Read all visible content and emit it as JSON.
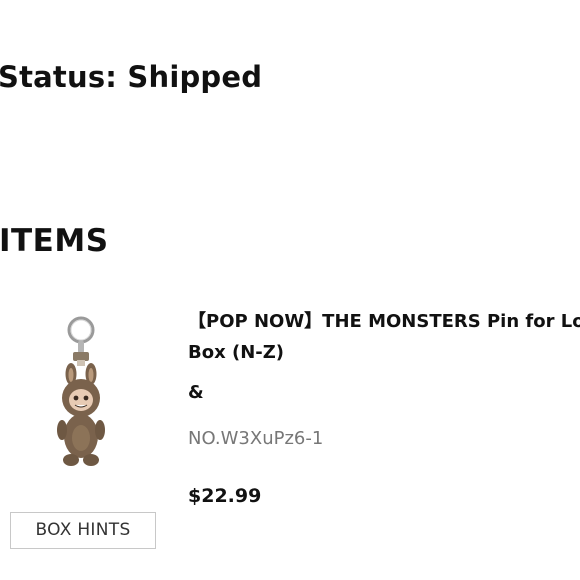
{
  "order": {
    "status_text": "Status: Shipped"
  },
  "items_section": {
    "heading": "ITEMS"
  },
  "item": {
    "title_line1": "【POP NOW】THE MONSTERS Pin for Lo",
    "title_line2": "Box (N-Z)",
    "ampersand": "&",
    "sku": "NO.W3XuPz6-1",
    "price": "$22.99",
    "thumbnail_icon": "monster-plush-keychain-icon"
  },
  "actions": {
    "box_hints_label": "BOX HINTS"
  },
  "colors": {
    "text": "#111111",
    "muted": "#777777",
    "button_border": "#c8c8c8",
    "plush_brown": "#7a624c"
  }
}
